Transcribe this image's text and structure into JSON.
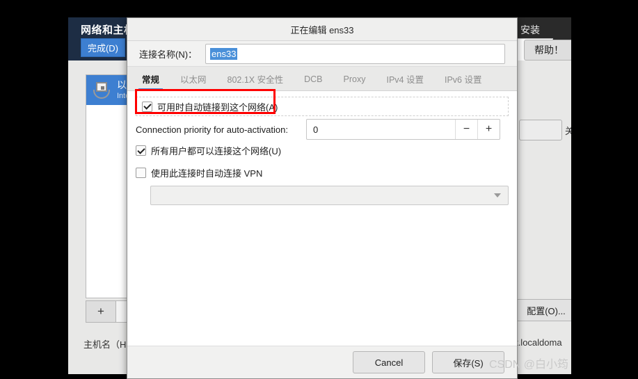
{
  "background_window": {
    "title": "网络和主机",
    "title_right": "安装",
    "done_button": "完成(D)",
    "help_button": "帮助！",
    "close_button": "关闭",
    "config_button": "配置(O)...",
    "add_button": "+",
    "remove_button": "−",
    "hostname_label": "主机名（H）",
    "hostname_value": "alhost.localdoma",
    "connection_list": [
      {
        "name": "以太",
        "detail": "Intel",
        "icon": "ethernet-icon",
        "selected": true
      }
    ]
  },
  "dialog": {
    "title": "正在编辑 ens33",
    "connection_name_label": "连接名称(N)：",
    "connection_name_value": "ens33",
    "tabs": [
      {
        "label": "常规",
        "active": true
      },
      {
        "label": "以太网",
        "active": false
      },
      {
        "label": "802.1X 安全性",
        "active": false
      },
      {
        "label": "DCB",
        "active": false
      },
      {
        "label": "Proxy",
        "active": false
      },
      {
        "label": "IPv4 设置",
        "active": false
      },
      {
        "label": "IPv6 设置",
        "active": false
      }
    ],
    "options": {
      "autoconnect_label": "可用时自动链接到这个网络(A)",
      "autoconnect_checked": true,
      "priority_label": "Connection priority for auto-activation:",
      "priority_value": "0",
      "priority_decrement": "−",
      "priority_increment": "+",
      "all_users_label": "所有用户都可以连接这个网络(U)",
      "all_users_checked": true,
      "vpn_label": "使用此连接时自动连接 VPN",
      "vpn_checked": false,
      "vpn_combo_value": ""
    },
    "footer": {
      "cancel_button": "Cancel",
      "save_button": "保存(S)"
    }
  },
  "annotation": {
    "highlight_color": "#ff0000"
  },
  "watermark": "CSDN @白小筠"
}
